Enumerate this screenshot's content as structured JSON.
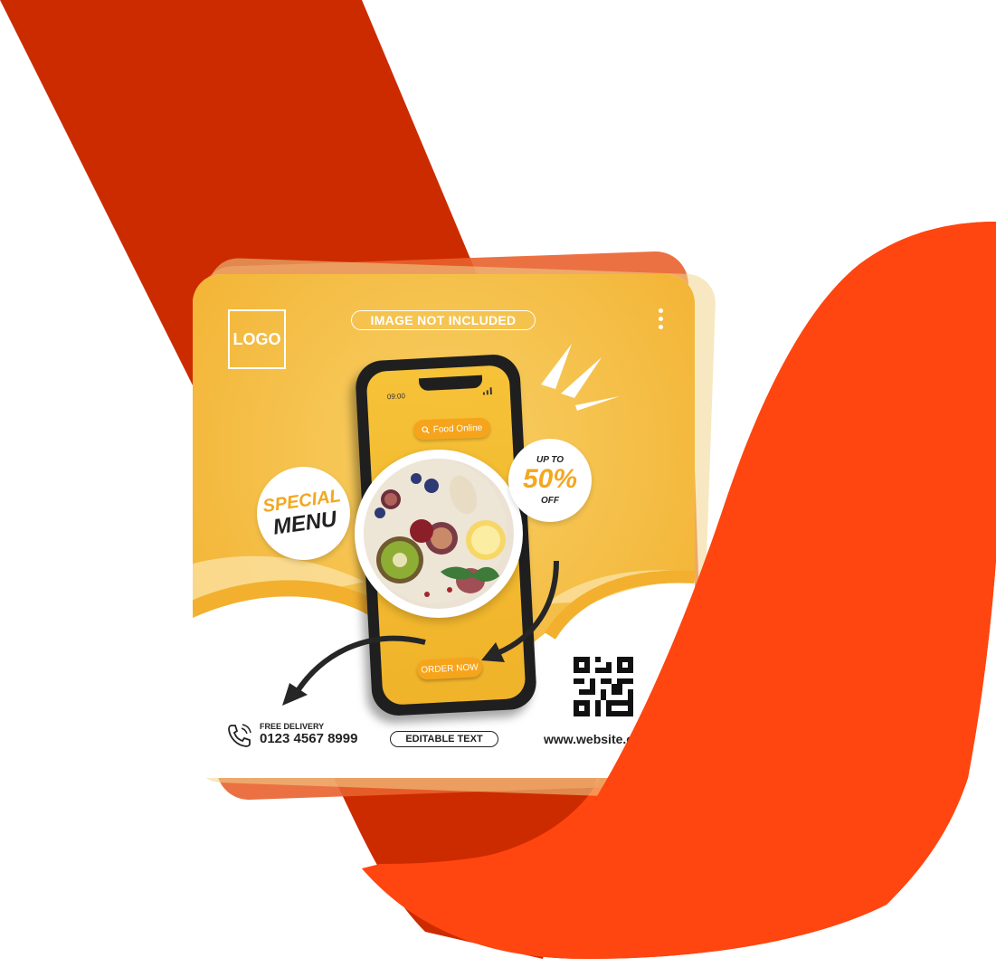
{
  "colors": {
    "dark_red": "#cc2b00",
    "orange_red": "#ff4510",
    "card_yellow": "#f4b93a",
    "accent_orange": "#f6a41c"
  },
  "card": {
    "logo_label": "LOGO",
    "top_pill": "IMAGE NOT INCLUDED",
    "search_label": "Food Online",
    "phone_time": "09:00",
    "badge_special_line1": "SPECIAL",
    "badge_special_line2": "MENU",
    "badge_discount_line1": "UP TO",
    "badge_discount_line2": "50%",
    "badge_discount_line3": "OFF",
    "order_button": "ORDER NOW",
    "delivery_label": "FREE DELIVERY",
    "phone_number": "0123 4567 8999",
    "editable_pill": "EDITABLE TEXT",
    "website": "www.website.c"
  },
  "icons": [
    "search-icon",
    "phone-icon",
    "qr-code",
    "menu-dots-icon",
    "arrow-icon"
  ]
}
